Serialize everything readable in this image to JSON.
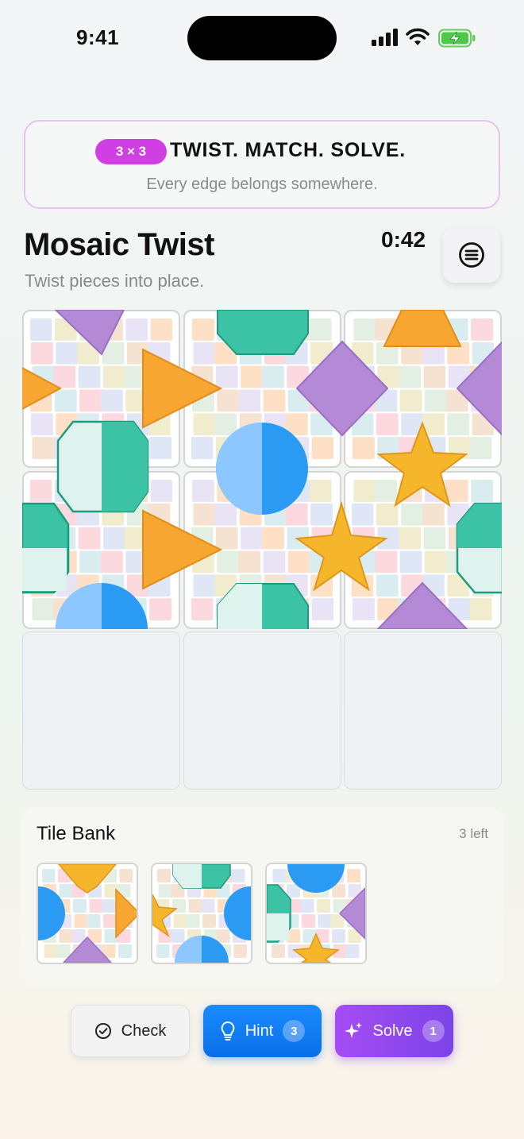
{
  "status_bar": {
    "time": "9:41"
  },
  "banner": {
    "badge": "3 × 3",
    "title": "TWIST. MATCH. SOLVE.",
    "subtitle": "Every edge belongs somewhere."
  },
  "header": {
    "title": "Mosaic Twist",
    "subtitle": "Twist pieces into place.",
    "timer": "0:42"
  },
  "board": {
    "size": "3 × 3",
    "placed_tiles": 6,
    "empty_slots": 3
  },
  "tile_bank": {
    "title": "Tile Bank",
    "count": "3 left"
  },
  "actions": {
    "check_label": "Check",
    "hint_label": "Hint",
    "hint_count": "3",
    "solve_label": "Solve",
    "solve_count": "1"
  },
  "colors": {
    "accent_magenta": "#cf3fe3",
    "hint_blue": "#0a6fe8",
    "solve_purple": "#8b48ee",
    "shape_orange": "#f7a632",
    "shape_teal": "#3cc2a4",
    "shape_blue": "#2b9af3",
    "shape_purple": "#b48ad6",
    "shape_gold": "#f6b62c"
  }
}
